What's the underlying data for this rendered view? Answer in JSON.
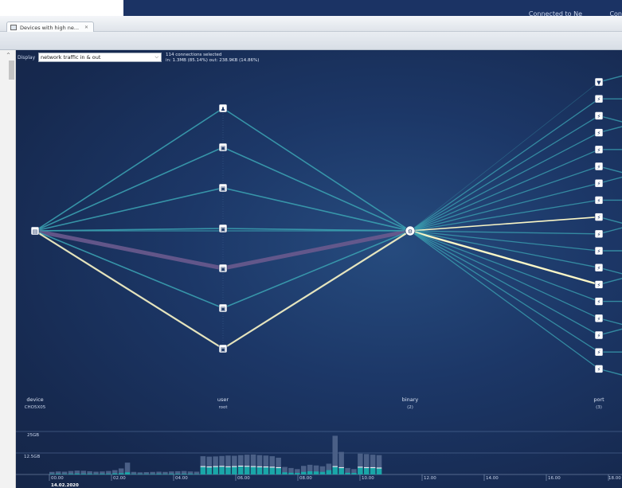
{
  "window": {
    "status_text": "Connected to Ne",
    "status_text_2": "Con"
  },
  "tab": {
    "label": "Devices with high ne..."
  },
  "toolbar": {
    "display_label": "Display",
    "display_value": "network traffic in & out",
    "selection_count": "114 connections selected",
    "selection_detail": "in: 1.3MB (85.14%) out: 238.9KB (14.86%)"
  },
  "axes": [
    {
      "name": "device",
      "value": "CHO5X05"
    },
    {
      "name": "user",
      "value": "root"
    },
    {
      "name": "binary",
      "value": "(2)"
    },
    {
      "name": "port",
      "value": "(3)"
    }
  ],
  "timeline": {
    "y_labels": [
      "25GB",
      "12.5GB"
    ],
    "ticks": [
      "00.00",
      "02.00",
      "04.00",
      "06.00",
      "08.00",
      "10.00",
      "12.00",
      "14.00",
      "16.00",
      "18.00"
    ],
    "date": "14.02.2020",
    "bars": [
      0.12,
      0.14,
      0.13,
      0.16,
      0.18,
      0.17,
      0.15,
      0.13,
      0.14,
      0.16,
      0.2,
      0.28,
      0.55,
      0.12,
      0.1,
      0.11,
      0.12,
      0.13,
      0.12,
      0.14,
      0.15,
      0.16,
      0.14,
      0.13,
      0.85,
      0.83,
      0.84,
      0.86,
      0.88,
      0.87,
      0.9,
      0.92,
      0.93,
      0.9,
      0.88,
      0.85,
      0.78,
      0.35,
      0.3,
      0.25,
      0.4,
      0.45,
      0.42,
      0.38,
      0.5,
      1.8,
      1.05,
      0.3,
      0.25,
      0.97,
      0.95,
      0.92,
      0.9
    ],
    "highlight": [
      0.02,
      0.03,
      0.02,
      0.03,
      0.04,
      0.03,
      0.03,
      0.02,
      0.03,
      0.03,
      0.05,
      0.06,
      0.1,
      0.02,
      0.02,
      0.02,
      0.02,
      0.03,
      0.02,
      0.03,
      0.03,
      0.03,
      0.03,
      0.02,
      0.35,
      0.33,
      0.35,
      0.36,
      0.34,
      0.35,
      0.37,
      0.36,
      0.35,
      0.34,
      0.33,
      0.32,
      0.3,
      0.1,
      0.08,
      0.07,
      0.12,
      0.15,
      0.14,
      0.12,
      0.2,
      0.35,
      0.3,
      0.08,
      0.07,
      0.32,
      0.3,
      0.3,
      0.28
    ]
  },
  "colors": {
    "bg": "#1c3767",
    "edge": "#3a9fb0",
    "edge_highlight": "#fbf7c7",
    "edge_thick": "#6a5a8e",
    "bar": "#4a5f86",
    "bar_highlight": "#1aa6a8"
  }
}
